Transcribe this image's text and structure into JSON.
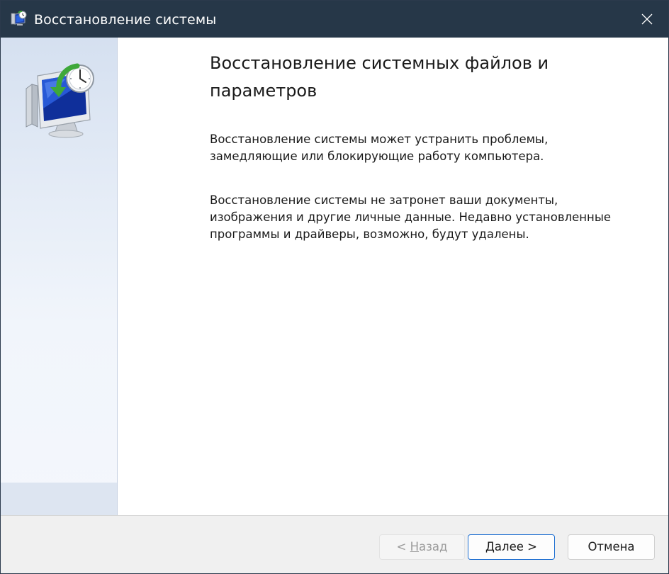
{
  "window": {
    "title": "Восстановление системы"
  },
  "page": {
    "heading": "Восстановление системных файлов и параметров",
    "paragraph1": "Восстановление системы может устранить проблемы,\nзамедляющие или блокирующие работу компьютера.",
    "paragraph2": "Восстановление системы не затронет ваши документы,\nизображения и другие личные данные. Недавно установленные\nпрограммы и драйверы, возможно, будут удалены."
  },
  "buttons": {
    "back_prefix": "< ",
    "back_accel": "Н",
    "back_rest": "азад",
    "next": "Далее >",
    "cancel": "Отмена"
  },
  "state": {
    "back_enabled": false,
    "default_button": "next"
  },
  "icons": {
    "title": "system-restore-icon",
    "close": "close-icon",
    "hero": "system-restore-monitor-clock-icon"
  },
  "colors": {
    "titlebar": "#263748",
    "accent_focus": "#1f6fd1",
    "side_panel": "#dde5f1",
    "clock_arrow": "#3ea83a"
  }
}
